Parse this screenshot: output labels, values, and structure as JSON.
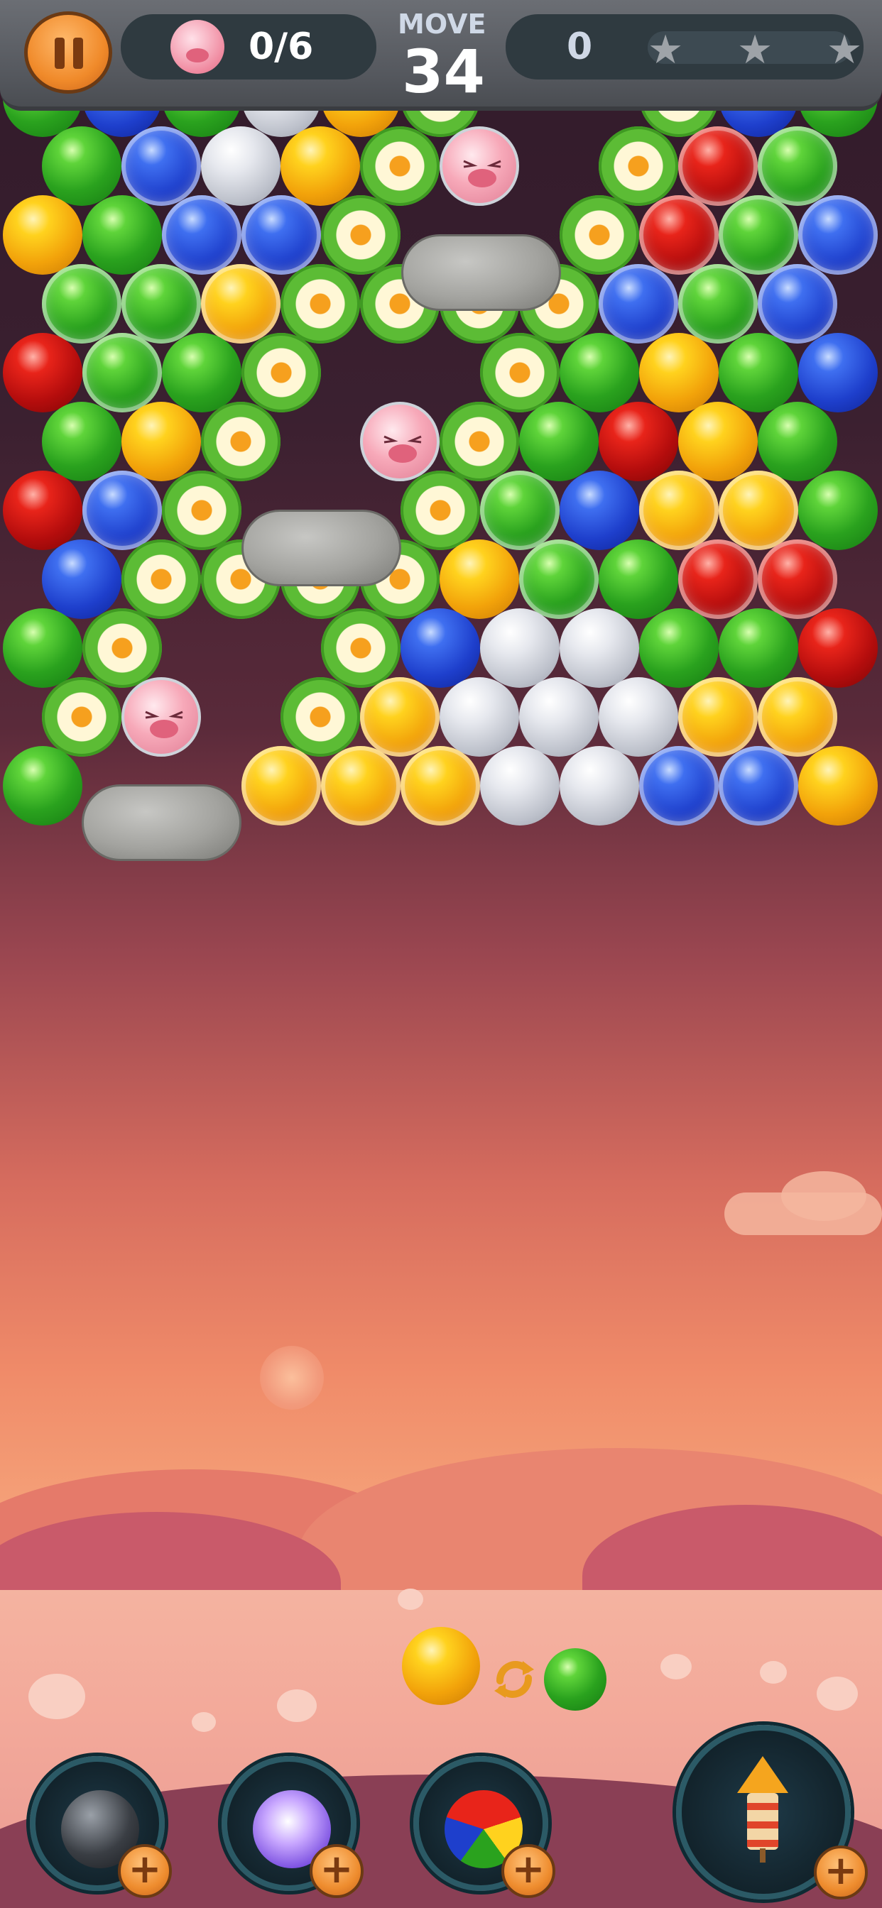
{
  "hud": {
    "pig_counter": "0/6",
    "move_label": "MOVE",
    "moves_left": "34",
    "score": "0",
    "stars_total": 3,
    "stars_earned": 0
  },
  "board": {
    "bubble_types": [
      "green",
      "blue",
      "yellow",
      "red",
      "silver",
      "flower",
      "pig",
      "rock"
    ],
    "frozen_types": [
      "green",
      "blue",
      "yellow",
      "red"
    ],
    "pigs_on_board": 3,
    "rocks_on_board": 3
  },
  "shooter": {
    "current_color": "yellow",
    "next_color": "green"
  },
  "boosters": [
    {
      "name": "bomb",
      "icon": "bomb-icon"
    },
    {
      "name": "lightning",
      "icon": "lightning-icon"
    },
    {
      "name": "rainbow",
      "icon": "rainbow-ball-icon"
    },
    {
      "name": "rocket",
      "icon": "rocket-icon"
    }
  ],
  "colors": {
    "accent_orange": "#f08a2a",
    "hud_dark": "#2f3a40",
    "hud_stone": "#55585e"
  }
}
